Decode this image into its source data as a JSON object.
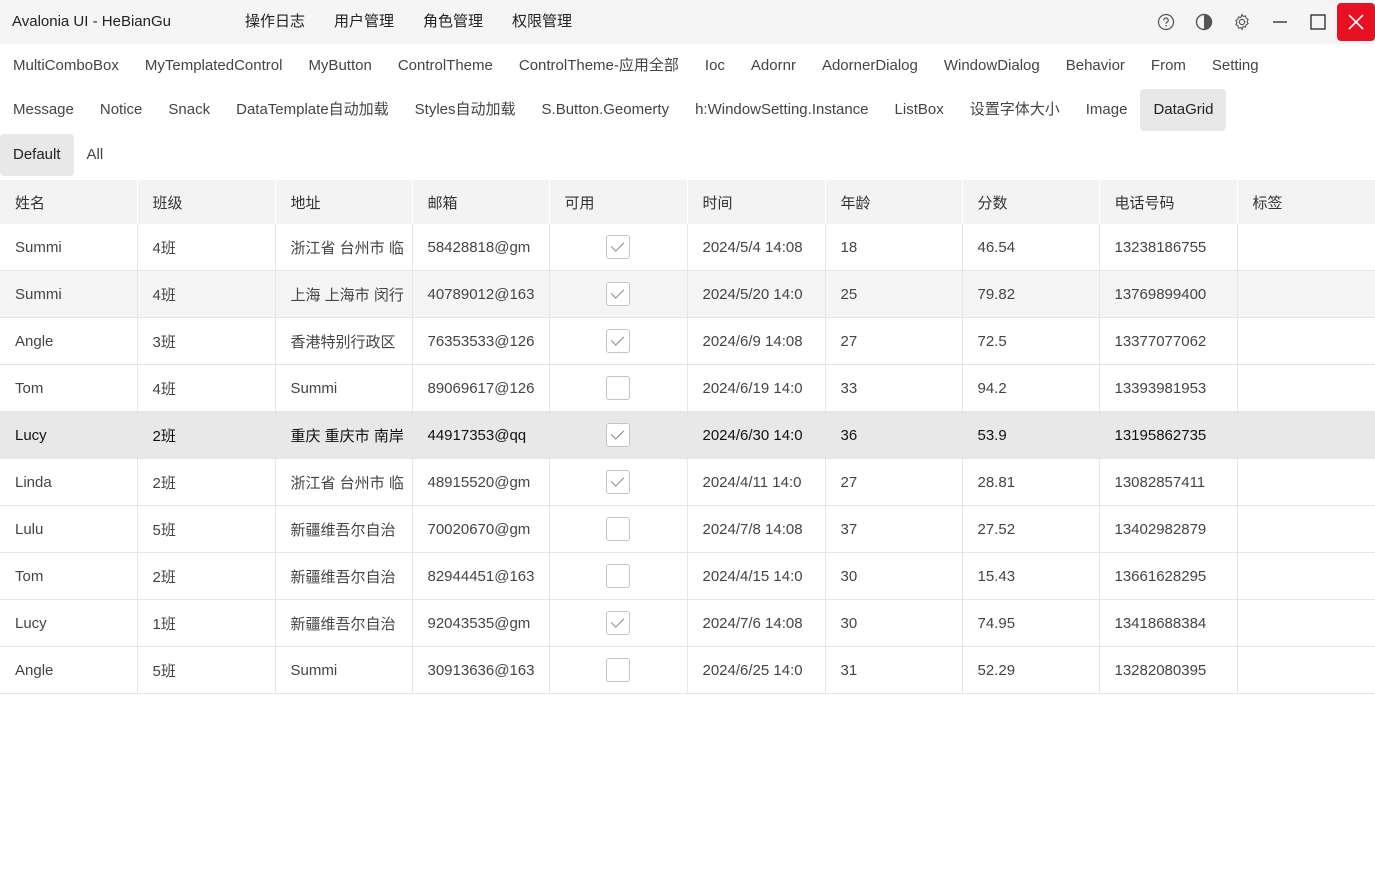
{
  "window": {
    "title": "Avalonia UI - HeBianGu",
    "menu": [
      "操作日志",
      "用户管理",
      "角色管理",
      "权限管理"
    ]
  },
  "tabs_row1": [
    "MultiComboBox",
    "MyTemplatedControl",
    "MyButton",
    "ControlTheme",
    "ControlTheme-应用全部",
    "Ioc",
    "Adornr",
    "AdornerDialog",
    "WindowDialog",
    "Behavior",
    "From",
    "Setting"
  ],
  "tabs_row2": [
    "Message",
    "Notice",
    "Snack",
    "DataTemplate自动加载",
    "Styles自动加载",
    "S.Button.Geomerty",
    "h:WindowSetting.Instance",
    "ListBox",
    "设置字体大小",
    "Image",
    "DataGrid"
  ],
  "tabs_row2_active": "DataGrid",
  "subtabs": [
    "Default",
    "All"
  ],
  "subtabs_active": "Default",
  "grid": {
    "columns": [
      "姓名",
      "班级",
      "地址",
      "邮箱",
      "可用",
      "时间",
      "年龄",
      "分数",
      "电话号码",
      "标签"
    ],
    "rows": [
      {
        "name": "Summi",
        "class": "4班",
        "address": "浙江省 台州市 临",
        "email": "58428818@gm",
        "enabled": true,
        "time": "2024/5/4 14:08",
        "age": "18",
        "score": "46.54",
        "phone": "13238186755",
        "tag": ""
      },
      {
        "name": "Summi",
        "class": "4班",
        "address": "上海 上海市 闵行",
        "email": "40789012@163",
        "enabled": true,
        "time": "2024/5/20 14:0",
        "age": "25",
        "score": "79.82",
        "phone": "13769899400",
        "tag": ""
      },
      {
        "name": "Angle",
        "class": "3班",
        "address": "香港特别行政区",
        "email": "76353533@126",
        "enabled": true,
        "time": "2024/6/9 14:08",
        "age": "27",
        "score": "72.5",
        "phone": "13377077062",
        "tag": ""
      },
      {
        "name": "Tom",
        "class": "4班",
        "address": "Summi",
        "email": "89069617@126",
        "enabled": false,
        "time": "2024/6/19 14:0",
        "age": "33",
        "score": "94.2",
        "phone": "13393981953",
        "tag": ""
      },
      {
        "name": "Lucy",
        "class": "2班",
        "address": "重庆 重庆市 南岸",
        "email": "44917353@qq",
        "enabled": true,
        "time": "2024/6/30 14:0",
        "age": "36",
        "score": "53.9",
        "phone": "13195862735",
        "tag": ""
      },
      {
        "name": "Linda",
        "class": "2班",
        "address": "浙江省 台州市 临",
        "email": "48915520@gm",
        "enabled": true,
        "time": "2024/4/11 14:0",
        "age": "27",
        "score": "28.81",
        "phone": "13082857411",
        "tag": ""
      },
      {
        "name": "Lulu",
        "class": "5班",
        "address": "新疆维吾尔自治",
        "email": "70020670@gm",
        "enabled": false,
        "time": "2024/7/8 14:08",
        "age": "37",
        "score": "27.52",
        "phone": "13402982879",
        "tag": ""
      },
      {
        "name": "Tom",
        "class": "2班",
        "address": "新疆维吾尔自治",
        "email": "82944451@163",
        "enabled": false,
        "time": "2024/4/15 14:0",
        "age": "30",
        "score": "15.43",
        "phone": "13661628295",
        "tag": ""
      },
      {
        "name": "Lucy",
        "class": "1班",
        "address": "新疆维吾尔自治",
        "email": "92043535@gm",
        "enabled": true,
        "time": "2024/7/6 14:08",
        "age": "30",
        "score": "74.95",
        "phone": "13418688384",
        "tag": ""
      },
      {
        "name": "Angle",
        "class": "5班",
        "address": "Summi",
        "email": "30913636@163",
        "enabled": false,
        "time": "2024/6/25 14:0",
        "age": "31",
        "score": "52.29",
        "phone": "13282080395",
        "tag": ""
      }
    ],
    "selected_row": 4,
    "alt_row": 1
  },
  "icons": [
    "help-icon",
    "theme-icon",
    "settings-icon",
    "minimize-icon",
    "maximize-icon",
    "close-icon"
  ],
  "colors": {
    "close_bg": "#e81123",
    "selected_row": "#e8e8e8",
    "header_bg": "#f3f3f3"
  }
}
